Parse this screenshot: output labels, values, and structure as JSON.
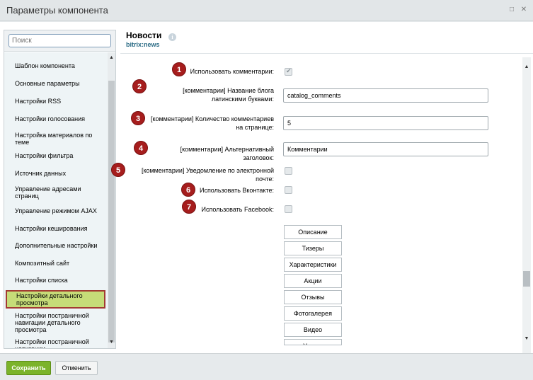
{
  "window": {
    "title": "Параметры компонента"
  },
  "sidebar": {
    "search_placeholder": "Поиск",
    "items": [
      {
        "label": "Шаблон компонента"
      },
      {
        "label": "Основные параметры"
      },
      {
        "label": "Настройки RSS"
      },
      {
        "label": "Настройки голосования"
      },
      {
        "label": "Настройка материалов по теме"
      },
      {
        "label": "Настройки фильтра"
      },
      {
        "label": "Источник данных"
      },
      {
        "label": "Управление адресами страниц"
      },
      {
        "label": "Управление режимом AJAX"
      },
      {
        "label": "Настройки кеширования"
      },
      {
        "label": "Дополнительные настройки"
      },
      {
        "label": "Композитный сайт"
      },
      {
        "label": "Настройки списка"
      },
      {
        "label": "Настройки детального просмотра",
        "active": true
      },
      {
        "label": "Настройки постраничной навигации детального просмотра"
      },
      {
        "label": "Настройки постраничной навигации"
      }
    ]
  },
  "main": {
    "title": "Новости",
    "info_icon": "info-icon",
    "subtitle": "bitrix:news",
    "rows": [
      {
        "badge": "1",
        "label": "Использовать комментарии:",
        "type": "checkbox",
        "checked": true
      },
      {
        "badge": "2",
        "label": "[комментарии] Название блога латинскими буквами:",
        "type": "input",
        "value": "catalog_comments"
      },
      {
        "badge": "3",
        "label": "[комментарии] Количество комментариев на странице:",
        "type": "input",
        "value": "5"
      },
      {
        "badge": "4",
        "label": "[комментарии] Альтернативный заголовок:",
        "type": "input",
        "value": "Комментарии"
      },
      {
        "badge": "5",
        "label": "[комментарии] Уведомление по электронной почте:",
        "type": "checkbox",
        "checked": false
      },
      {
        "badge": "6",
        "label": "Использовать Вконтакте:",
        "type": "checkbox",
        "checked": false
      },
      {
        "badge": "7",
        "label": "Использовать Facebook:",
        "type": "checkbox",
        "checked": false
      }
    ],
    "tab_buttons": [
      "Описание",
      "Тизеры",
      "Характеристики",
      "Акции",
      "Отзывы",
      "Фотогалерея",
      "Видео",
      "Услуги"
    ]
  },
  "footer": {
    "save_label": "Сохранить",
    "cancel_label": "Отменить"
  },
  "colors": {
    "badge": "#a61d1d",
    "active_item": "#c6dc78",
    "save_button": "#7bb32a",
    "subtitle": "#2a6b85"
  }
}
